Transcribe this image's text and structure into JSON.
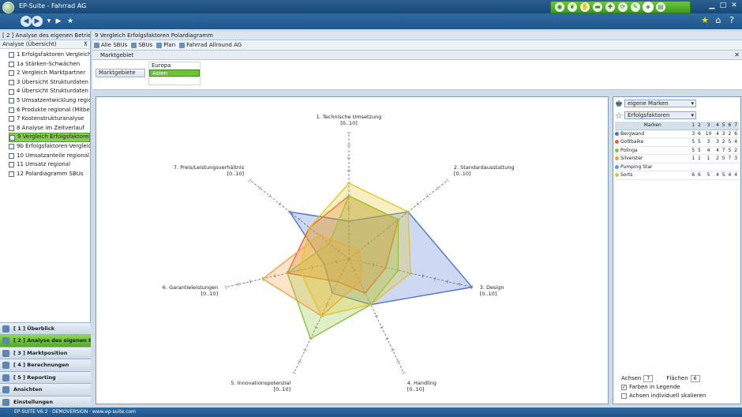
{
  "app": {
    "title": "EP-Suite - Fahrrad AG"
  },
  "leftpanel": {
    "header": "[ 2 ] Analyse des eigenen Betriebs",
    "subheader": "Analyse (Übersicht)",
    "items": [
      "1 Erfolgsfaktoren Vergleich",
      "1a Stärken-Schwächen",
      "2 Vergleich Marktpartner",
      "3 Übersicht Strukturdaten",
      "4 Übersicht Strukturdaten",
      "5 Umsatzentwicklung regional",
      "6 Produkte regional (Mitbewerber)",
      "7 Kostenstrukturanalyse",
      "8 Analyse im Zeitverlauf",
      "9 Vergleich Erfolgsfaktoren",
      "9b Erfolgsfaktoren-Vergleich",
      "10 Umsatzanteile regional",
      "11 Umsatz regional",
      "12 Polardiagramm SBUs"
    ],
    "selected_index": 9,
    "nav": [
      {
        "label": "[ 1 ] Überblick",
        "active": false
      },
      {
        "label": "[ 2 ] Analyse des eigenen Betriebs",
        "active": true
      },
      {
        "label": "[ 3 ] Marktposition",
        "active": false
      },
      {
        "label": "[ 4 ] Berechnungen",
        "active": false
      },
      {
        "label": "[ 5 ] Reporting",
        "active": false
      },
      {
        "label": "Ansichten",
        "active": false
      },
      {
        "label": "Einstellungen",
        "active": false
      }
    ]
  },
  "main": {
    "breadcrumb": "9 Vergleich Erfolgsfaktoren Polardiagramm",
    "tabs": [
      "Alle SBUs",
      "SBUs",
      "Plan",
      "Fahrrad Allround AG"
    ],
    "marktgebiet_label": "Marktgebiet",
    "filter": {
      "chevron": "Marktgebiete",
      "regions": [
        "Europa",
        "Asien"
      ],
      "selected_region": "Asien"
    }
  },
  "chart_data": {
    "type": "radar",
    "axes": [
      {
        "label": "1. Technische Umsetzung",
        "range_label": "[0..10]"
      },
      {
        "label": "2. Standardausstattung",
        "range_label": "[0..10]"
      },
      {
        "label": "3. Design",
        "range_label": "[0..10]"
      },
      {
        "label": "4. Handling",
        "range_label": "[0..10]"
      },
      {
        "label": "5. Innovationspotenzial",
        "range_label": "[0..10]"
      },
      {
        "label": "6. Garantieleistungen",
        "range_label": "[0..10]"
      },
      {
        "label": "7. Preis/Leistungsverhältnis",
        "range_label": "[0..10]"
      }
    ],
    "max": 10,
    "series": [
      {
        "name": "Bergwand",
        "color": "#4d74d1",
        "values": [
          3,
          6,
          10,
          4,
          3,
          2,
          6
        ]
      },
      {
        "name": "Gottbaike",
        "color": "#ee5f2b",
        "values": [
          5,
          5,
          3,
          3,
          2,
          5,
          4
        ]
      },
      {
        "name": "Polinga",
        "color": "#8ac43a",
        "values": [
          5,
          5,
          4,
          4,
          7,
          5,
          2
        ]
      },
      {
        "name": "Silverster",
        "color": "#f0a040",
        "values": [
          1,
          1,
          1,
          2,
          5,
          7,
          3
        ]
      },
      {
        "name": "Sorts",
        "color": "#e3c628",
        "values": [
          6,
          6,
          5,
          4,
          5,
          4,
          4
        ]
      }
    ]
  },
  "side": {
    "selects": [
      "eigene Marken",
      "Erfolgsfaktoren"
    ],
    "table_header": [
      "Marken",
      "1",
      "2",
      "3",
      "4",
      "5",
      "6",
      "7"
    ],
    "rows": [
      {
        "name": "Bergwand",
        "color": "#4d74d1",
        "vals": [
          "3",
          "6",
          "10",
          "4",
          "3",
          "2",
          "6"
        ]
      },
      {
        "name": "Gottbaike",
        "color": "#ee5f2b",
        "vals": [
          "5",
          "5",
          "3",
          "3",
          "2",
          "5",
          "4"
        ]
      },
      {
        "name": "Polinga",
        "color": "#8ac43a",
        "vals": [
          "5",
          "5",
          "4",
          "4",
          "7",
          "5",
          "2"
        ]
      },
      {
        "name": "Silverster",
        "color": "#f0a040",
        "vals": [
          "1",
          "1",
          "1",
          "2",
          "5",
          "7",
          "3"
        ]
      },
      {
        "name": "Pumping Star",
        "color": "#4da2d9",
        "vals": [
          "",
          "",
          "",
          "",
          "",
          "",
          ""
        ]
      },
      {
        "name": "Sorts",
        "color": "#e3c628",
        "vals": [
          "6",
          "6",
          "5",
          "4",
          "5",
          "4",
          "4"
        ]
      }
    ],
    "achsen_label": "Achsen",
    "achsen_value": "7",
    "flaechen_label": "Flächen",
    "flaechen_value": "6",
    "cb1": "Farben in Legende",
    "cb2": "Achsen individuell skalieren"
  },
  "status": {
    "text": "EP-SUITE V6.2 · DEMOVERSION · www.ep-suite.com"
  }
}
